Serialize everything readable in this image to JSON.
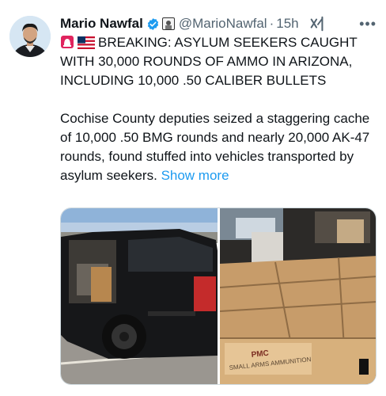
{
  "author": {
    "name": "Mario Nawfal",
    "handle": "@MarioNawfal",
    "separator": "·",
    "time": "15h"
  },
  "tweet": {
    "headline": "BREAKING: ASYLUM SEEKERS CAUGHT WITH 30,000 ROUNDS OF AMMO IN ARIZONA, INCLUDING 10,000 .50 CALIBER BULLETS",
    "body": "Cochise County deputies seized a staggering cache of 10,000 .50 BMG rounds and nearly 20,000 AK-47 rounds, found stuffed into vehicles transported by asylum seekers.",
    "show_more": "Show more"
  },
  "media": {
    "box_label": "SMALL ARMS AMMUNITION",
    "box_brand": "PMC"
  },
  "icons": {
    "verified": "verified-badge-icon",
    "org": "affiliate-org-icon",
    "grok": "grok-icon",
    "more": "more-options-icon",
    "siren": "siren-emoji-icon",
    "flag": "us-flag-emoji-icon"
  },
  "colors": {
    "accent": "#1d9bf0",
    "text": "#0f1419",
    "muted": "#536471"
  }
}
